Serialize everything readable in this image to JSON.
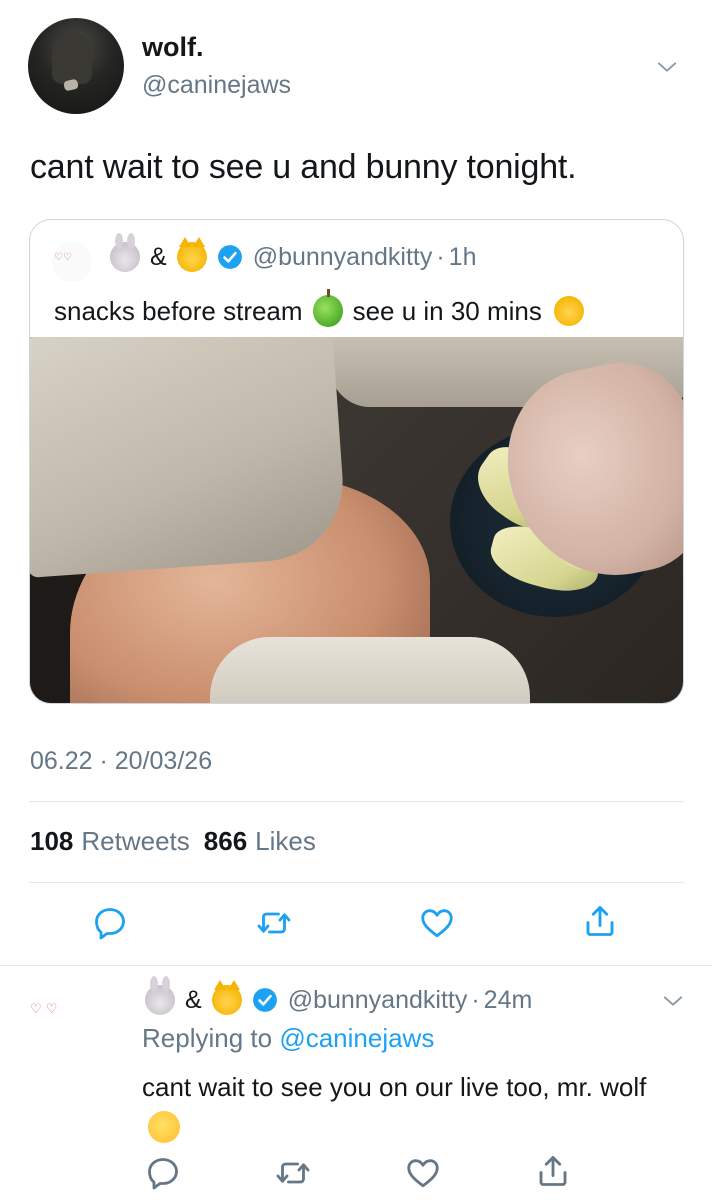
{
  "main_tweet": {
    "display_name": "wolf.",
    "handle": "@caninejaws",
    "text": "cant wait to see u and bunny tonight.",
    "timestamp": "06.22 · 20/03/26",
    "stats": {
      "retweets_count": "108",
      "retweets_label": "Retweets",
      "likes_count": "866",
      "likes_label": "Likes"
    }
  },
  "quoted_tweet": {
    "amp": "&",
    "handle": "@bunnyandkitty",
    "separator": "·",
    "time": "1h",
    "text_part1": "snacks before stream",
    "text_part2": "see u in 30 mins"
  },
  "reply": {
    "amp": "&",
    "handle": "@bunnyandkitty",
    "separator": "·",
    "time": "24m",
    "replying_prefix": "Replying to",
    "replying_mention": "@caninejaws",
    "text": "cant wait to see you on our live too, mr. wolf"
  },
  "icons": {
    "reply": "reply-icon",
    "retweet": "retweet-icon",
    "like": "heart-icon",
    "share": "share-icon",
    "verified": "verified-badge-icon",
    "more": "chevron-down-icon"
  },
  "colors": {
    "text_primary": "#14171a",
    "text_secondary": "#657786",
    "accent": "#1da1f2",
    "divider": "#e1e8ed"
  }
}
